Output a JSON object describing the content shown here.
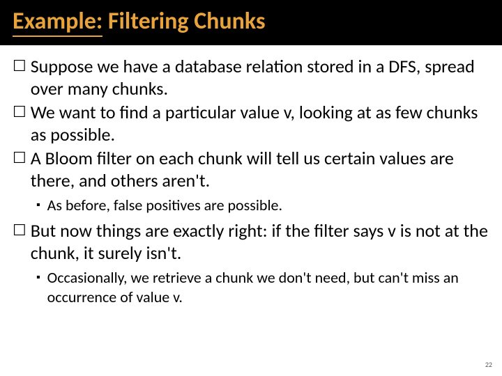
{
  "title": {
    "prefix": "Example:",
    "suffix": " Filtering Chunks"
  },
  "bullets": [
    {
      "level": 1,
      "marker": "☐",
      "text": "Suppose we have a database relation stored in a DFS, spread over many chunks."
    },
    {
      "level": 1,
      "marker": "☐",
      "text": "We want to find a particular value v, looking at as few chunks as possible."
    },
    {
      "level": 1,
      "marker": "☐",
      "text": "A Bloom filter on each chunk will tell us certain values are there, and others aren't."
    },
    {
      "level": 2,
      "marker": "▪",
      "text": "As before, false positives are possible."
    },
    {
      "level": 1,
      "marker": "☐",
      "text": "But now things are exactly right: if the filter says v is not at the chunk, it surely isn't."
    },
    {
      "level": 2,
      "marker": "▪",
      "text": "Occasionally, we retrieve a chunk we don't need, but can't miss an occurrence of value v."
    }
  ],
  "pageNumber": "22"
}
